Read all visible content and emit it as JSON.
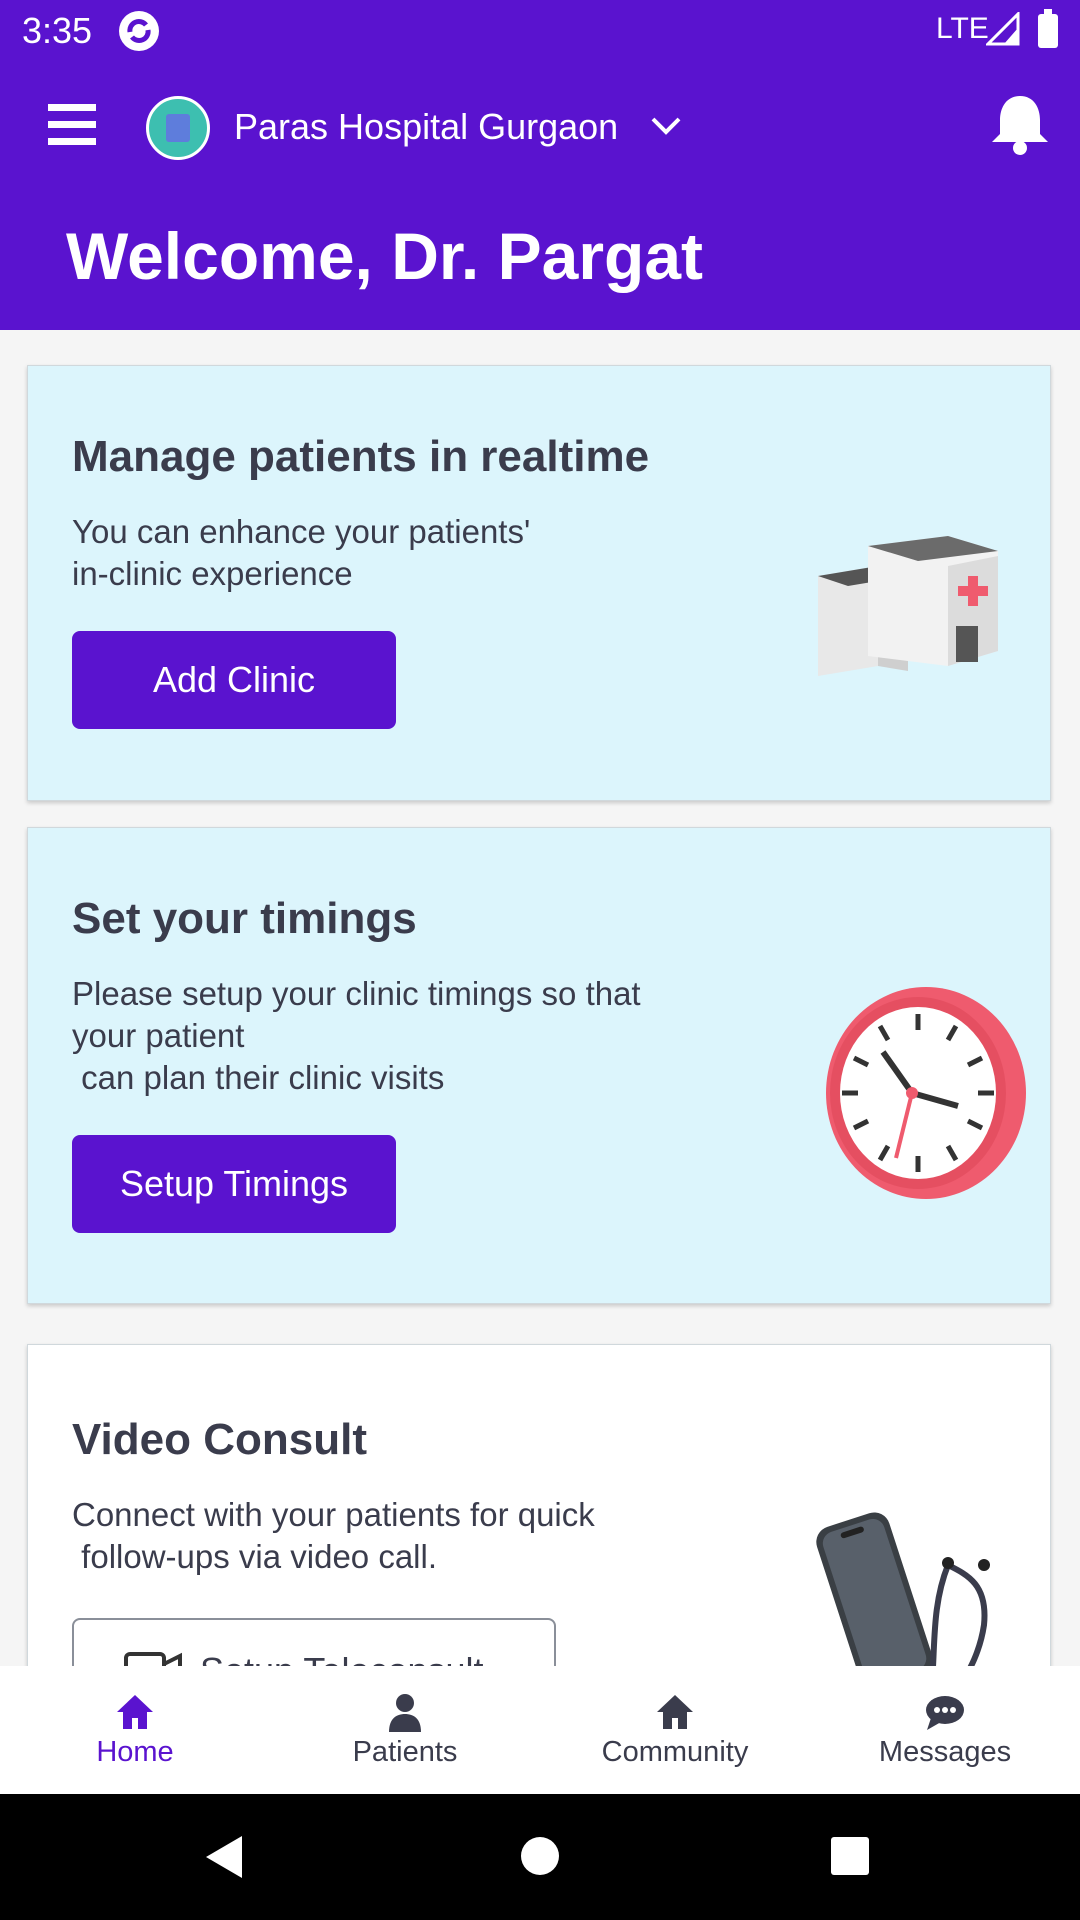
{
  "status_bar": {
    "time": "3:35",
    "network": "LTE"
  },
  "header": {
    "hospital_name": "Paras Hospital Gurgaon",
    "welcome": "Welcome, Dr. Pargat"
  },
  "cards": [
    {
      "title": "Manage patients in realtime",
      "description": "You can enhance your patients'\nin-clinic experience",
      "button": "Add Clinic"
    },
    {
      "title": "Set your timings",
      "description": "Please setup your clinic timings so that\nyour patient\n can plan their clinic visits",
      "button": "Setup Timings"
    },
    {
      "title": "Video Consult",
      "description": "Connect with your patients for quick\n follow-ups via video call.",
      "button": "Setup Teleconsult"
    }
  ],
  "bottom_nav": [
    {
      "label": "Home",
      "icon": "home-icon",
      "active": true
    },
    {
      "label": "Patients",
      "icon": "person-icon",
      "active": false
    },
    {
      "label": "Community",
      "icon": "community-icon",
      "active": false
    },
    {
      "label": "Messages",
      "icon": "chat-icon",
      "active": false
    }
  ],
  "colors": {
    "primary": "#5a13cf",
    "card_blue": "#dcf5fc",
    "text": "#3a3c4c"
  }
}
